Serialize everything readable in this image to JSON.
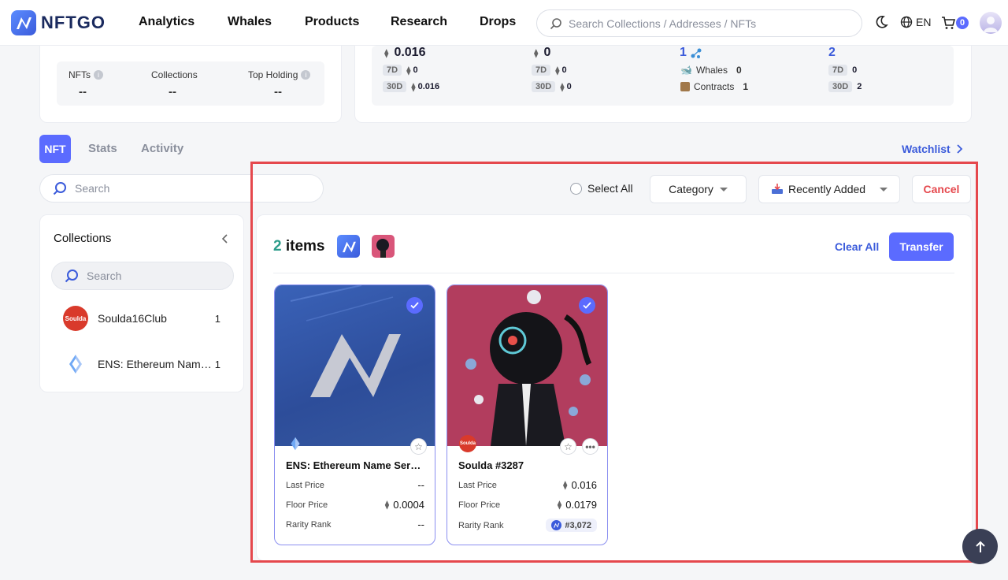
{
  "header": {
    "logo_text": "NFTGO",
    "nav": [
      "Analytics",
      "Whales",
      "Products",
      "Research",
      "Drops"
    ],
    "search_placeholder": "Search Collections / Addresses / NFTs",
    "lang": "EN",
    "cart_count": "0"
  },
  "profile_stats": {
    "nfts_label": "NFTs",
    "nfts_value": "--",
    "collections_label": "Collections",
    "collections_value": "--",
    "top_holding_label": "Top Holding",
    "top_holding_value": "--"
  },
  "overview": {
    "col1": {
      "value": "0.016",
      "p7d": "7D",
      "v7d": "0",
      "p30d": "30D",
      "v30d": "0.016"
    },
    "col2": {
      "value": "0",
      "p7d": "7D",
      "v7d": "0",
      "p30d": "30D",
      "v30d": "0"
    },
    "col3": {
      "value": "1",
      "whales_label": "Whales",
      "whales_value": "0",
      "contracts_label": "Contracts",
      "contracts_value": "1"
    },
    "col4": {
      "value": "2",
      "p7d": "7D",
      "v7d": "0",
      "p30d": "30D",
      "v30d": "2"
    }
  },
  "tabs": [
    "NFT",
    "Stats",
    "Activity"
  ],
  "watchlist_label": "Watchlist",
  "left": {
    "search_placeholder": "Search",
    "collections_title": "Collections",
    "collection_search_placeholder": "Search",
    "collections": [
      {
        "name": "Soulda16Club",
        "count": "1",
        "logo_text": "Soulda"
      },
      {
        "name": "ENS: Ethereum Name Service",
        "count": "1"
      }
    ]
  },
  "toolbar": {
    "select_all": "Select All",
    "category": "Category",
    "sort": "Recently Added",
    "cancel": "Cancel"
  },
  "selection": {
    "count": "2",
    "items_label": "items",
    "clear_all": "Clear All",
    "transfer": "Transfer"
  },
  "nfts": [
    {
      "name": "ENS: Ethereum Name Service",
      "last_price_label": "Last Price",
      "last_price": "--",
      "floor_price_label": "Floor Price",
      "floor_price": "0.0004",
      "rarity_label": "Rarity Rank",
      "rarity": "--"
    },
    {
      "name": "Soulda #3287",
      "badge_text": "Soulda",
      "last_price_label": "Last Price",
      "last_price": "0.016",
      "floor_price_label": "Floor Price",
      "floor_price": "0.0179",
      "rarity_label": "Rarity Rank",
      "rarity": "#3,072"
    }
  ],
  "colors": {
    "accent": "#5b6bff",
    "link": "#3b5bdb",
    "danger": "#e5484d",
    "count": "#2b9c8a"
  }
}
